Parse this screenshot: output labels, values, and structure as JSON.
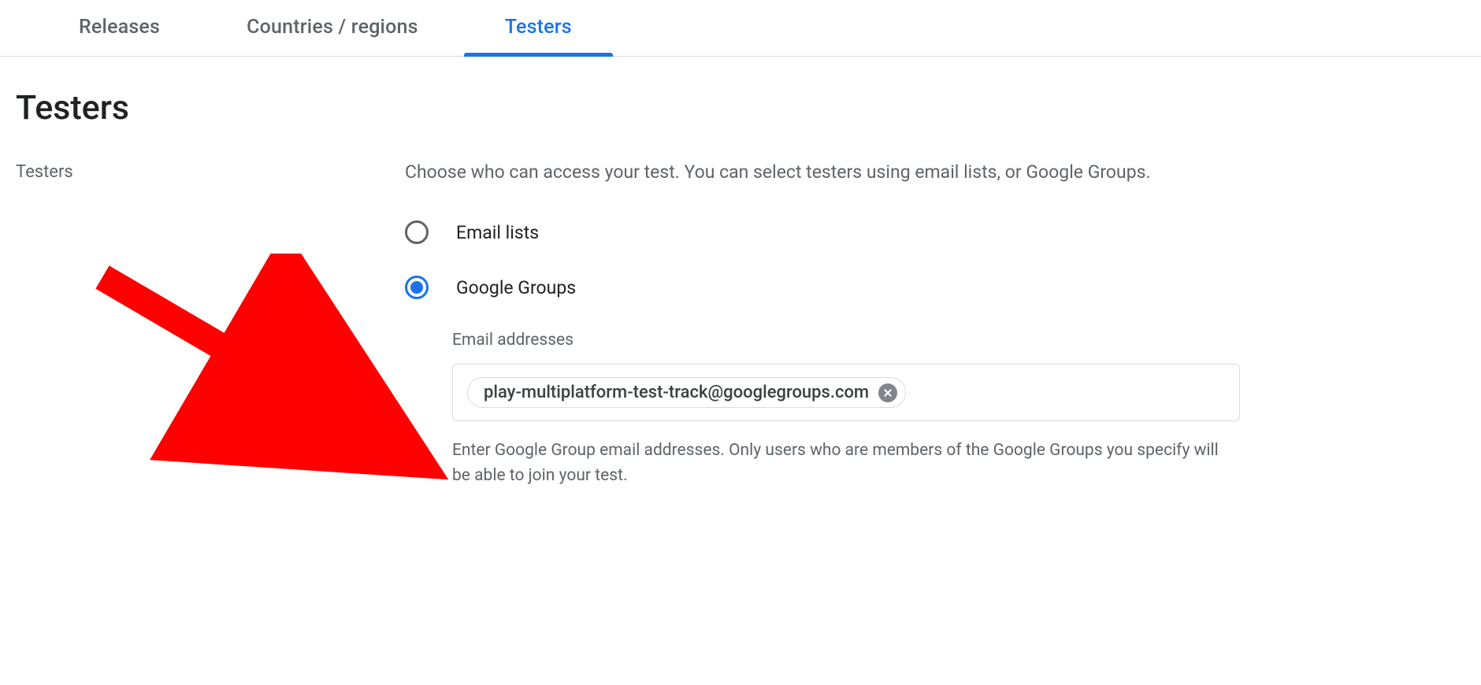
{
  "tabs": [
    {
      "label": "Releases",
      "active": false
    },
    {
      "label": "Countries / regions",
      "active": false
    },
    {
      "label": "Testers",
      "active": true
    }
  ],
  "page": {
    "title": "Testers",
    "section_label": "Testers",
    "description": "Choose who can access your test. You can select testers using email lists, or Google Groups.",
    "radio_options": [
      {
        "label": "Email lists",
        "selected": false
      },
      {
        "label": "Google Groups",
        "selected": true
      }
    ],
    "email_field": {
      "label": "Email addresses",
      "chips": [
        "play-multiplatform-test-track@googlegroups.com"
      ],
      "help": "Enter Google Group email addresses. Only users who are members of the Google Groups you specify will be able to join your test."
    }
  }
}
